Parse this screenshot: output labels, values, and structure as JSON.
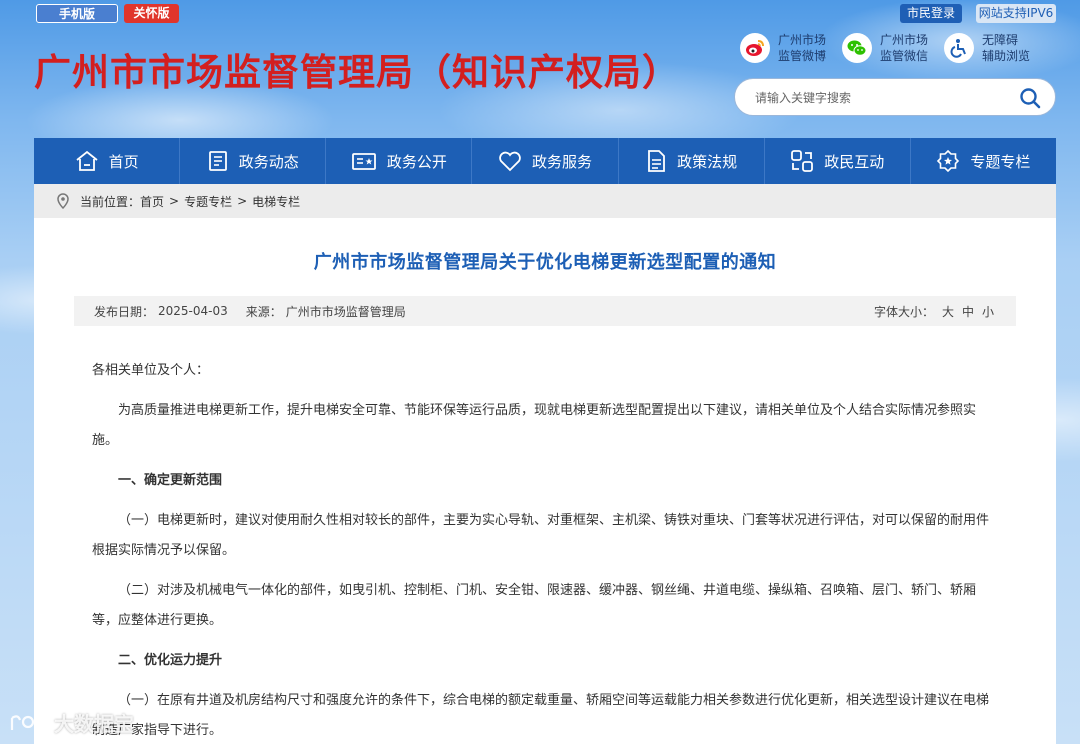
{
  "top_bar": {
    "mobile_label": "手机版",
    "care_label": "关怀版",
    "login_label": "市民登录",
    "ipv6_label": "网站支持IPV6"
  },
  "header": {
    "site_title": "广州市市场监督管理局（知识产权局）",
    "quick_links": [
      {
        "icon": "weibo-icon",
        "line1": "广州市场",
        "line2": "监管微博"
      },
      {
        "icon": "wechat-icon",
        "line1": "广州市场",
        "line2": "监管微信"
      },
      {
        "icon": "accessibility-icon",
        "line1": "无障碍",
        "line2": "辅助浏览"
      }
    ],
    "search_placeholder": "请输入关键字搜索"
  },
  "nav": {
    "items": [
      {
        "label": "首页",
        "icon": "home-icon"
      },
      {
        "label": "政务动态",
        "icon": "news-icon"
      },
      {
        "label": "政务公开",
        "icon": "public-icon"
      },
      {
        "label": "政务服务",
        "icon": "heart-icon"
      },
      {
        "label": "政策法规",
        "icon": "document-icon"
      },
      {
        "label": "政民互动",
        "icon": "interaction-icon"
      },
      {
        "label": "专题专栏",
        "icon": "special-icon"
      }
    ]
  },
  "breadcrumb": {
    "prefix": "当前位置：",
    "items": [
      "首页",
      "专题专栏",
      "电梯专栏"
    ],
    "separator": ">"
  },
  "article": {
    "title": "广州市市场监督管理局关于优化电梯更新选型配置的通知",
    "date_label": "发布日期：",
    "date": "2025-04-03",
    "source_label": "来源：",
    "source": "广州市市场监督管理局",
    "font_size_label": "字体大小：",
    "font_sizes": [
      "大",
      "中",
      "小"
    ],
    "paragraphs": {
      "salute": "各相关单位及个人：",
      "intro": "为高质量推进电梯更新工作，提升电梯安全可靠、节能环保等运行品质，现就电梯更新选型配置提出以下建议，请相关单位及个人结合实际情况参照实施。",
      "heading1": "一、确定更新范围",
      "item1_1": "（一）电梯更新时，建议对使用耐久性相对较长的部件，主要为实心导轨、对重框架、主机梁、铸铁对重块、门套等状况进行评估，对可以保留的耐用件根据实际情况予以保留。",
      "item1_2": "（二）对涉及机械电气一体化的部件，如曳引机、控制柜、门机、安全钳、限速器、缓冲器、钢丝绳、井道电缆、操纵箱、召唤箱、层门、轿门、轿厢等，应整体进行更换。",
      "heading2": "二、优化运力提升",
      "item2_1": "（一）在原有井道及机房结构尺寸和强度允许的条件下，综合电梯的额定载重量、轿厢空间等运载能力相关参数进行优化更新，相关选型设计建议在电梯制造厂家指导下进行。"
    }
  },
  "watermark": "大数据宝"
}
